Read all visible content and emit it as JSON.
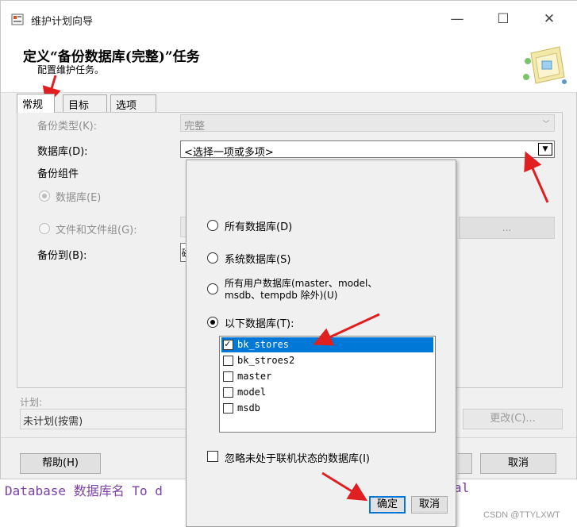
{
  "window": {
    "title": "维护计划向导",
    "minimize_glyph": "—",
    "maximize_glyph": "☐",
    "close_glyph": "✕"
  },
  "header": {
    "title": "定义“备份数据库(完整)”任务",
    "subtitle": "配置维护任务。",
    "graphic_icon": "wizard-graphic-icon"
  },
  "tabs": [
    {
      "label": "常规",
      "active": true
    },
    {
      "label": "目标",
      "active": false
    },
    {
      "label": "选项",
      "active": false
    }
  ],
  "general": {
    "backup_type_label": "备份类型(K):",
    "backup_type_value": "完整",
    "database_label": "数据库(D):",
    "database_value": "<选择一项或多项>",
    "backup_component_label": "备份组件",
    "component_database_label": "数据库(E)",
    "component_files_label": "文件和文件组(G):",
    "ellipsis_label": "...",
    "backup_to_label": "备份到(B):",
    "backup_to_value_partial": "磁"
  },
  "schedule": {
    "label": "计划:",
    "value": "未计划(按需)",
    "change_label": "更改(C)..."
  },
  "footer": {
    "help_label": "帮助(H)",
    "cancel_label": "取消"
  },
  "background_code": {
    "left_text": "Database 数据库名 To d",
    "right_text": "al"
  },
  "popup": {
    "options": [
      {
        "label": "所有数据库(D)",
        "selected": false
      },
      {
        "label": "系统数据库(S)",
        "selected": false
      },
      {
        "label_line1": "所有用户数据库(master、model、",
        "label_line2": "msdb、tempdb 除外)(U)",
        "selected": false
      },
      {
        "label": "以下数据库(T):",
        "selected": true
      }
    ],
    "databases": [
      {
        "name": "bk_stores",
        "checked": true,
        "highlighted": true
      },
      {
        "name": "bk_stroes2",
        "checked": false,
        "highlighted": false
      },
      {
        "name": "master",
        "checked": false,
        "highlighted": false
      },
      {
        "name": "model",
        "checked": false,
        "highlighted": false
      },
      {
        "name": "msdb",
        "checked": false,
        "highlighted": false
      }
    ],
    "ignore_offline_label": "忽略未处于联机状态的数据库(I)",
    "ok_label": "确定",
    "cancel_label": "取消"
  },
  "watermark": "CSDN @TTYLXWT",
  "colors": {
    "selection": "#0078d7",
    "annotation_arrow": "#e02020",
    "code_text": "#7b3fa6"
  }
}
